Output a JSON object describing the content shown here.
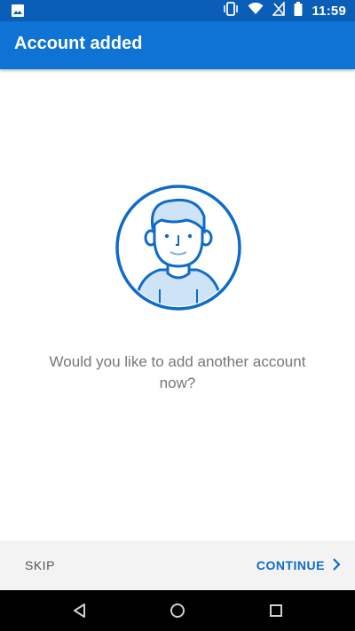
{
  "status_bar": {
    "time": "11:59",
    "icons": [
      "image-icon",
      "vibrate-icon",
      "wifi-icon",
      "no-sim-icon",
      "battery-icon"
    ]
  },
  "app_bar": {
    "title": "Account added"
  },
  "main": {
    "avatar_icon": "person-avatar-icon",
    "message": "Would you like to add another account now?"
  },
  "footer": {
    "skip_label": "SKIP",
    "continue_label": "CONTINUE",
    "continue_icon": "chevron-right-icon"
  },
  "nav_bar": {
    "icons": [
      "back-icon",
      "home-icon",
      "recents-icon"
    ]
  },
  "colors": {
    "status_bar": "#0a5eb8",
    "app_bar": "#0f73d5",
    "accent": "#0f6bc9",
    "avatar_fill": "#cfe3f6",
    "footer_bg": "#f3f3f3",
    "message_text": "#777777"
  }
}
